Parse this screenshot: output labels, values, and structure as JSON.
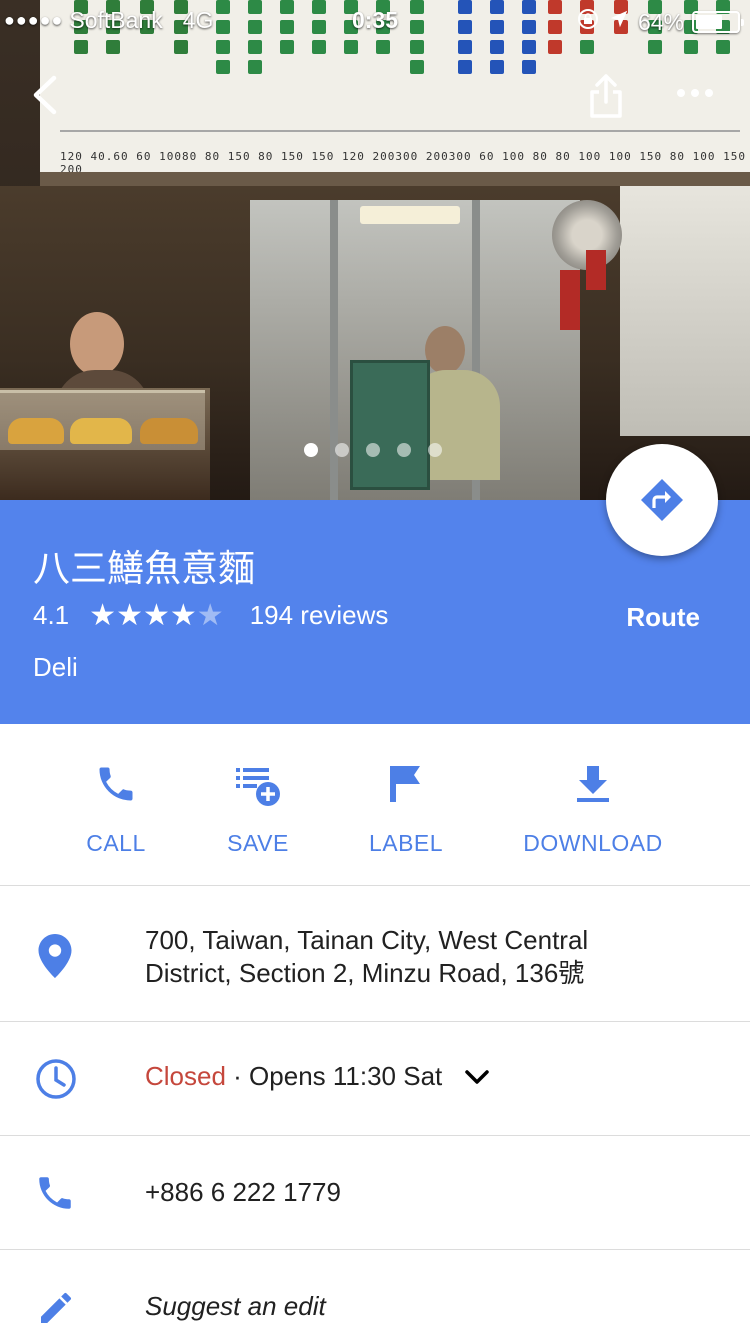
{
  "status_bar": {
    "carrier": "SoftBank",
    "network": "4G",
    "time": "0:35",
    "battery_percent": "64%",
    "battery_level": 0.64
  },
  "hero": {
    "photo_count": 5,
    "active_photo_index": 0
  },
  "place": {
    "name": "八三鱔魚意麵",
    "rating": "4.1",
    "stars_filled": 4,
    "stars_total": 5,
    "reviews": "194 reviews",
    "category": "Deli",
    "route_label": "Route"
  },
  "actions": [
    {
      "label": "CALL",
      "icon": "phone-icon"
    },
    {
      "label": "SAVE",
      "icon": "playlist-add-icon"
    },
    {
      "label": "LABEL",
      "icon": "flag-icon"
    },
    {
      "label": "DOWNLOAD",
      "icon": "download-icon"
    }
  ],
  "details": {
    "address_line1": "700, Taiwan, Tainan City, West Central",
    "address_line2": "District, Section 2, Minzu Road, 136號",
    "hours_status": "Closed",
    "hours_separator": " · ",
    "hours_next": "Opens 11:30 Sat",
    "phone": "+886 6 222 1779",
    "suggest_edit": "Suggest an edit"
  },
  "colors": {
    "accent_blue": "#5383ec",
    "icon_blue": "#4d7fe6",
    "closed_red": "#c5473c"
  }
}
